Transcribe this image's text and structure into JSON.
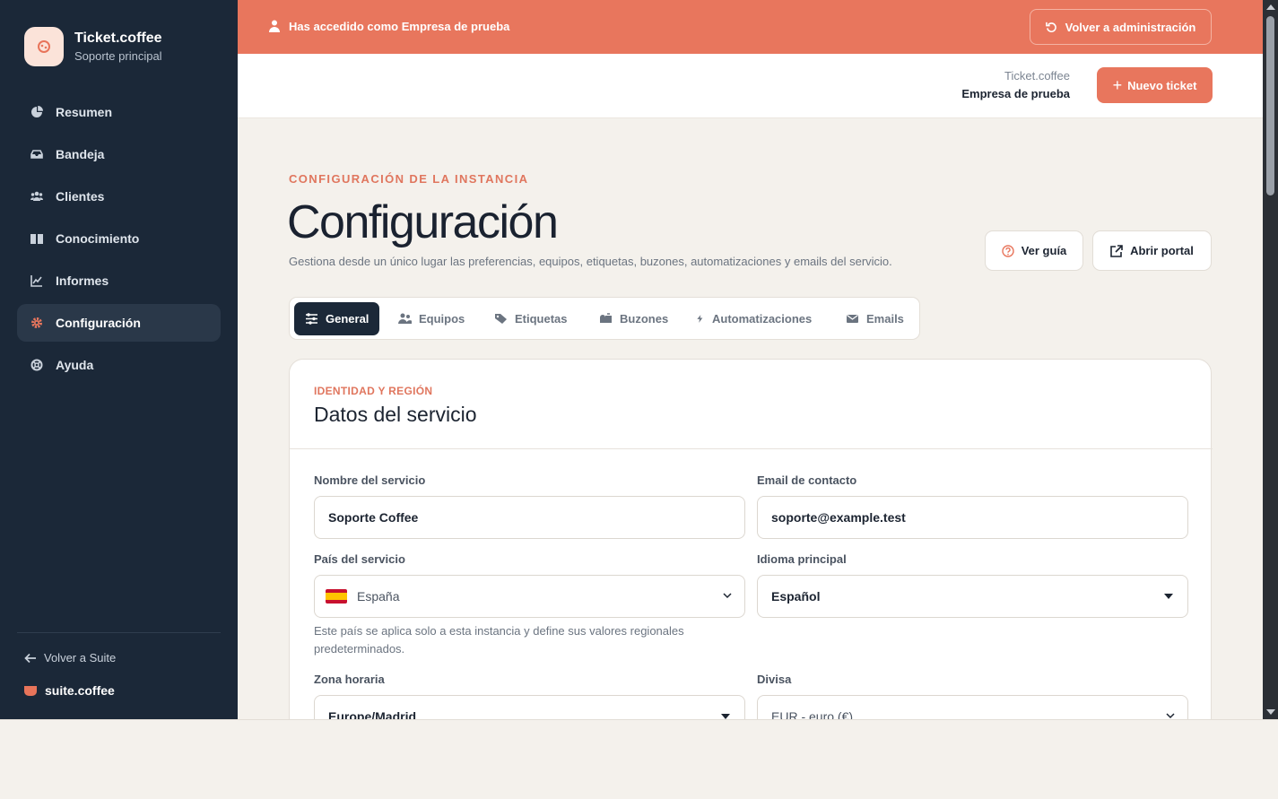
{
  "brand": {
    "name": "Ticket.coffee",
    "subtitle": "Soporte principal"
  },
  "sidebar": {
    "items": [
      {
        "label": "Resumen",
        "icon": "pie-chart-icon"
      },
      {
        "label": "Bandeja",
        "icon": "inbox-icon"
      },
      {
        "label": "Clientes",
        "icon": "users-icon"
      },
      {
        "label": "Conocimiento",
        "icon": "book-icon"
      },
      {
        "label": "Informes",
        "icon": "line-chart-icon"
      },
      {
        "label": "Configuración",
        "icon": "gear-icon",
        "active": true
      },
      {
        "label": "Ayuda",
        "icon": "lifebuoy-icon"
      }
    ],
    "back_label": "Volver a Suite",
    "suite_name": "suite.coffee"
  },
  "banner": {
    "text": "Has accedido como Empresa de prueba",
    "back_button": "Volver a administración"
  },
  "topbar": {
    "app_name": "Ticket.coffee",
    "org_name": "Empresa de prueba",
    "new_ticket": "Nuevo ticket"
  },
  "page": {
    "eyebrow": "CONFIGURACIÓN DE LA INSTANCIA",
    "title": "Configuración",
    "description": "Gestiona desde un único lugar las preferencias, equipos, etiquetas, buzones, automatizaciones y emails del servicio.",
    "guide_button": "Ver guía",
    "portal_button": "Abrir portal"
  },
  "tabs": [
    {
      "label": "General",
      "icon": "sliders-icon",
      "active": true
    },
    {
      "label": "Equipos",
      "icon": "users-icon"
    },
    {
      "label": "Etiquetas",
      "icon": "tags-icon"
    },
    {
      "label": "Buzones",
      "icon": "mailbox-icon"
    },
    {
      "label": "Automatizaciones",
      "icon": "bolt-icon"
    },
    {
      "label": "Emails",
      "icon": "envelope-icon"
    }
  ],
  "card": {
    "eyebrow": "IDENTIDAD Y REGIÓN",
    "title": "Datos del servicio",
    "fields": {
      "service_name": {
        "label": "Nombre del servicio",
        "value": "Soporte Coffee"
      },
      "contact_email": {
        "label": "Email de contacto",
        "value": "soporte@example.test"
      },
      "country": {
        "label": "País del servicio",
        "value": "España",
        "flag": "spain-flag-icon"
      },
      "language": {
        "label": "Idioma principal",
        "value": "Español"
      },
      "country_help": "Este país se aplica solo a esta instancia y define sus valores regionales predeterminados.",
      "timezone": {
        "label": "Zona horaria",
        "value": "Europe/Madrid"
      },
      "currency": {
        "label": "Divisa",
        "value": "EUR - euro (€)"
      }
    }
  },
  "colors": {
    "sidebar_bg": "#1b2838",
    "accent": "#e8765d",
    "page_bg": "#f4f1ec"
  }
}
